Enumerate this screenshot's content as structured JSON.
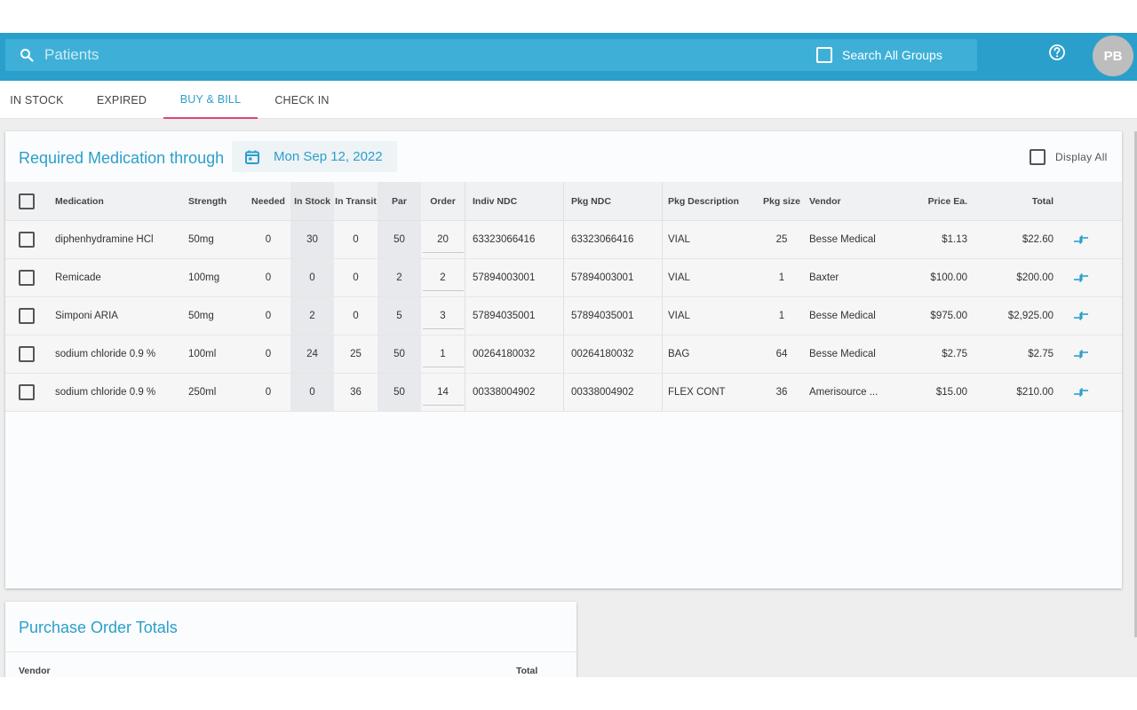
{
  "header": {
    "search_placeholder": "Patients",
    "search_all_groups_label": "Search All Groups",
    "avatar_initials": "PB"
  },
  "tabs": [
    {
      "label": "IN STOCK"
    },
    {
      "label": "EXPIRED"
    },
    {
      "label": "BUY & BILL",
      "active": true
    },
    {
      "label": "CHECK IN"
    }
  ],
  "required": {
    "title": "Required Medication through",
    "date": "Mon Sep 12, 2022",
    "display_all_label": "Display All"
  },
  "table": {
    "columns": {
      "medication": "Medication",
      "strength": "Strength",
      "needed": "Needed",
      "in_stock": "In Stock",
      "in_transit": "In Transit",
      "par": "Par",
      "order": "Order",
      "indiv_ndc": "Indiv NDC",
      "pkg_ndc": "Pkg NDC",
      "pkg_description": "Pkg Description",
      "pkg_size": "Pkg size",
      "vendor": "Vendor",
      "price_ea": "Price Ea.",
      "total": "Total"
    },
    "rows": [
      {
        "medication": "diphenhydramine HCl",
        "strength": "50mg",
        "needed": "0",
        "in_stock": "30",
        "in_transit": "0",
        "par": "50",
        "order": "20",
        "indiv_ndc": "63323066416",
        "pkg_ndc": "63323066416",
        "pkg_description": "VIAL",
        "pkg_size": "25",
        "vendor": "Besse Medical",
        "price_ea": "$1.13",
        "total": "$22.60"
      },
      {
        "medication": "Remicade",
        "strength": "100mg",
        "needed": "0",
        "in_stock": "0",
        "in_transit": "0",
        "par": "2",
        "order": "2",
        "indiv_ndc": "57894003001",
        "pkg_ndc": "57894003001",
        "pkg_description": "VIAL",
        "pkg_size": "1",
        "vendor": "Baxter",
        "price_ea": "$100.00",
        "total": "$200.00"
      },
      {
        "medication": "Simponi ARIA",
        "strength": "50mg",
        "needed": "0",
        "in_stock": "2",
        "in_transit": "0",
        "par": "5",
        "order": "3",
        "indiv_ndc": "57894035001",
        "pkg_ndc": "57894035001",
        "pkg_description": "VIAL",
        "pkg_size": "1",
        "vendor": "Besse Medical",
        "price_ea": "$975.00",
        "total": "$2,925.00"
      },
      {
        "medication": "sodium chloride 0.9 %",
        "strength": "100ml",
        "needed": "0",
        "in_stock": "24",
        "in_transit": "25",
        "par": "50",
        "order": "1",
        "indiv_ndc": "00264180032",
        "pkg_ndc": "00264180032",
        "pkg_description": "BAG",
        "pkg_size": "64",
        "vendor": "Besse Medical",
        "price_ea": "$2.75",
        "total": "$2.75"
      },
      {
        "medication": "sodium chloride 0.9 %",
        "strength": "250ml",
        "needed": "0",
        "in_stock": "0",
        "in_transit": "36",
        "par": "50",
        "order": "14",
        "indiv_ndc": "00338004902",
        "pkg_ndc": "00338004902",
        "pkg_description": "FLEX CONT",
        "pkg_size": "36",
        "vendor": "Amerisource ...",
        "price_ea": "$15.00",
        "total": "$210.00"
      }
    ]
  },
  "purchase_order": {
    "title": "Purchase Order Totals",
    "vendor_header": "Vendor",
    "total_header": "Total"
  },
  "colors": {
    "topbar": "#2b9fcb",
    "accent": "#2b9fcb",
    "tab_indicator": "#e0457b"
  }
}
